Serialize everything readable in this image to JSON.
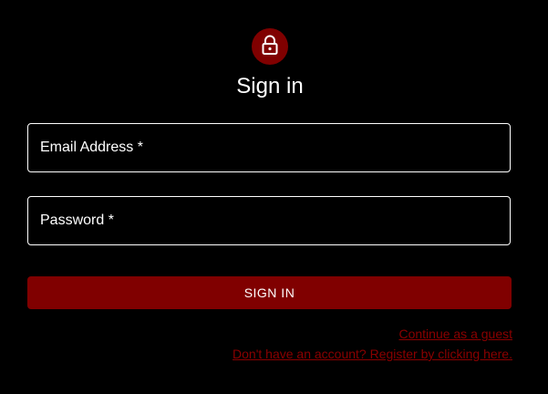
{
  "colors": {
    "background": "#000000",
    "accent": "#800000",
    "link": "#8b0000",
    "text": "#ffffff"
  },
  "header": {
    "icon": "lock-icon",
    "title": "Sign in"
  },
  "form": {
    "email": {
      "label": "Email Address *",
      "value": ""
    },
    "password": {
      "label": "Password *",
      "value": ""
    },
    "submit_label": "SIGN IN"
  },
  "links": {
    "guest": "Continue as a guest",
    "register": "Don't have an account? Register by clicking here."
  }
}
